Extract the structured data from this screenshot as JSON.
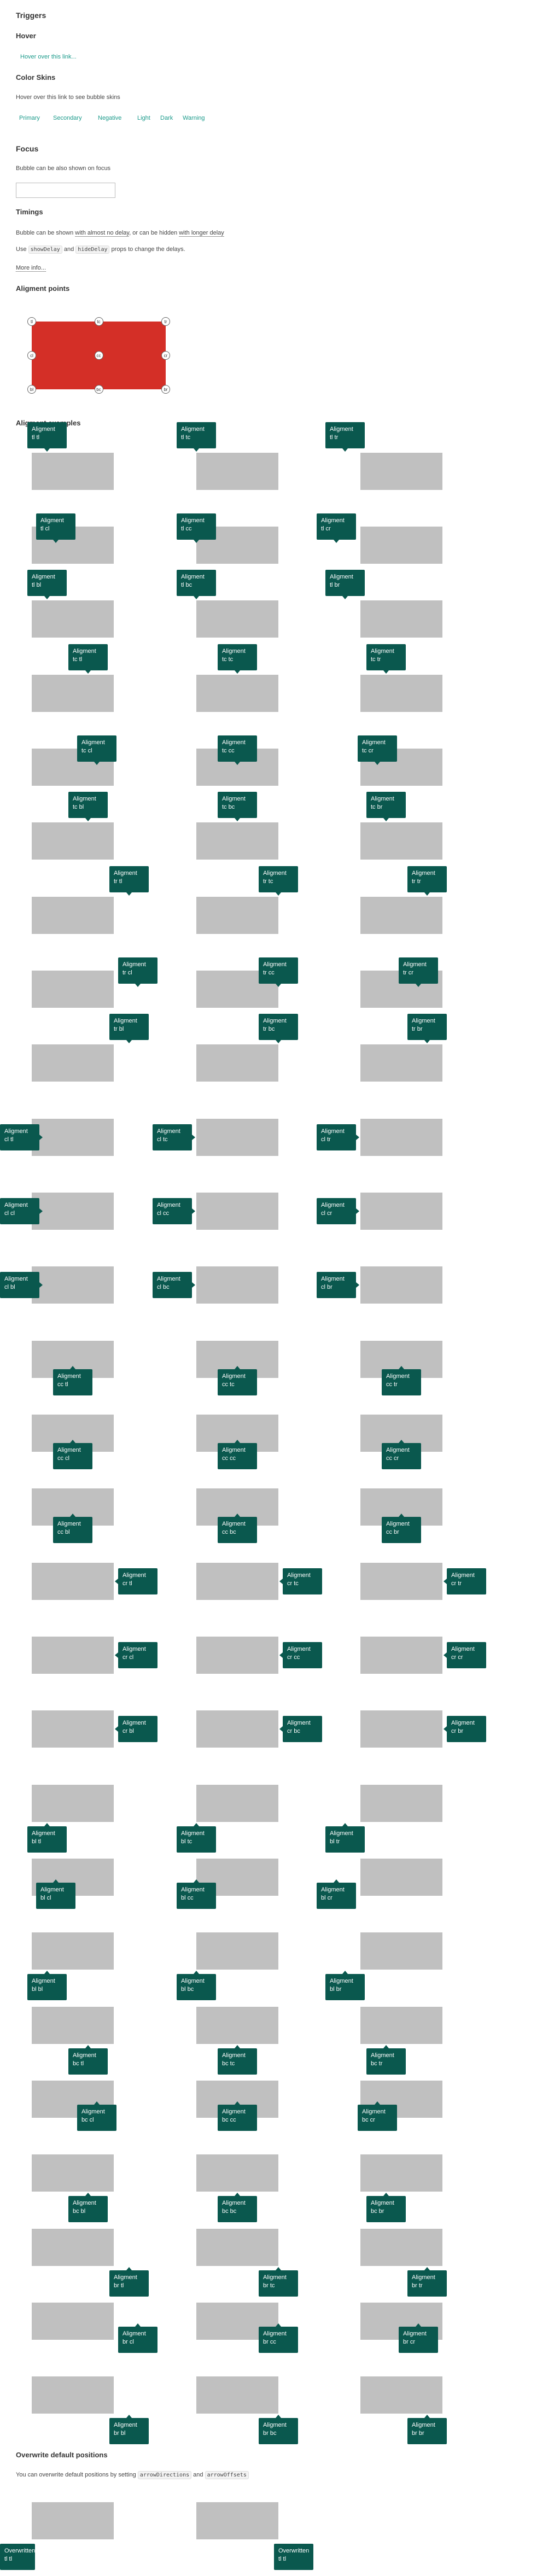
{
  "triggers": {
    "title": "Triggers",
    "hover_title": "Hover",
    "hover_link": "Hover over this link...",
    "skins_title": "Color Skins",
    "skins_text": "Hover over this link to see bubble skins",
    "skins": [
      "Primary",
      "Secondary",
      "Negative",
      "Light",
      "Dark",
      "Warning"
    ]
  },
  "focus": {
    "title": "Focus",
    "text": "Bubble can be also shown on focus",
    "input_value": ""
  },
  "timings": {
    "title": "Timings",
    "text_a": "Bubble can be shown ",
    "text_link1": "with almost no delay",
    "text_b": ", or can be hidden ",
    "text_link2": "with longer delay",
    "use": "Use",
    "code1": "showDelay",
    "and": "and",
    "code2": "hideDelay",
    "props": "props to change the delays.",
    "more": "More info..."
  },
  "alignment_points": {
    "title": "Aligment points",
    "points": [
      "tl",
      "tc",
      "tr",
      "cl",
      "cc",
      "cr",
      "bl",
      "bc",
      "br"
    ]
  },
  "alignment_examples": {
    "title": "Aligment examples",
    "label": "Aligment",
    "codes": [
      [
        "tl tl",
        "tl tc",
        "tl tr",
        "tl cl",
        "tl cc",
        "tl cr",
        "tl bl",
        "tl bc",
        "tl br"
      ],
      [
        "tc tl",
        "tc tc",
        "tc tr",
        "tc cl",
        "tc cc",
        "tc cr",
        "tc bl",
        "tc bc",
        "tc br"
      ],
      [
        "tr tl",
        "tr tc",
        "tr tr",
        "tr cl",
        "tr cc",
        "tr cr",
        "tr bl",
        "tr bc",
        "tr br"
      ],
      [
        "cl tl",
        "cl tc",
        "cl tr",
        "cl cl",
        "cl cc",
        "cl cr",
        "cl bl",
        "cl bc",
        "cl br"
      ],
      [
        "cc tl",
        "cc tc",
        "cc tr",
        "cc cl",
        "cc cc",
        "cc cr",
        "cc bl",
        "cc bc",
        "cc br"
      ],
      [
        "cr tl",
        "cr tc",
        "cr tr",
        "cr cl",
        "cr cc",
        "cr cr",
        "cr bl",
        "cr bc",
        "cr br"
      ],
      [
        "bl tl",
        "bl tc",
        "bl tr",
        "bl cl",
        "bl cc",
        "bl cr",
        "bl bl",
        "bl bc",
        "bl br"
      ],
      [
        "bc tl",
        "bc tc",
        "bc tr",
        "bc cl",
        "bc cc",
        "bc cr",
        "bc bl",
        "bc bc",
        "bc br"
      ],
      [
        "br tl",
        "br tc",
        "br tr",
        "br cl",
        "br cc",
        "br cr",
        "br bl",
        "br bc",
        "br br"
      ]
    ]
  },
  "overwrite": {
    "title": "Overwrite default positions",
    "text": "You can overwrite default positions by setting",
    "code1": "arrowDirections",
    "and": "and",
    "code2": "arrowOffsets",
    "bubble1": [
      "Overwritten",
      "tl tl"
    ],
    "bubble2": [
      "Overwritten",
      "tl tl"
    ]
  },
  "colors": {
    "accent": "#1a9a8a",
    "bubble": "#0a584e",
    "red": "#d42f27",
    "gray": "#c0c0c0"
  }
}
